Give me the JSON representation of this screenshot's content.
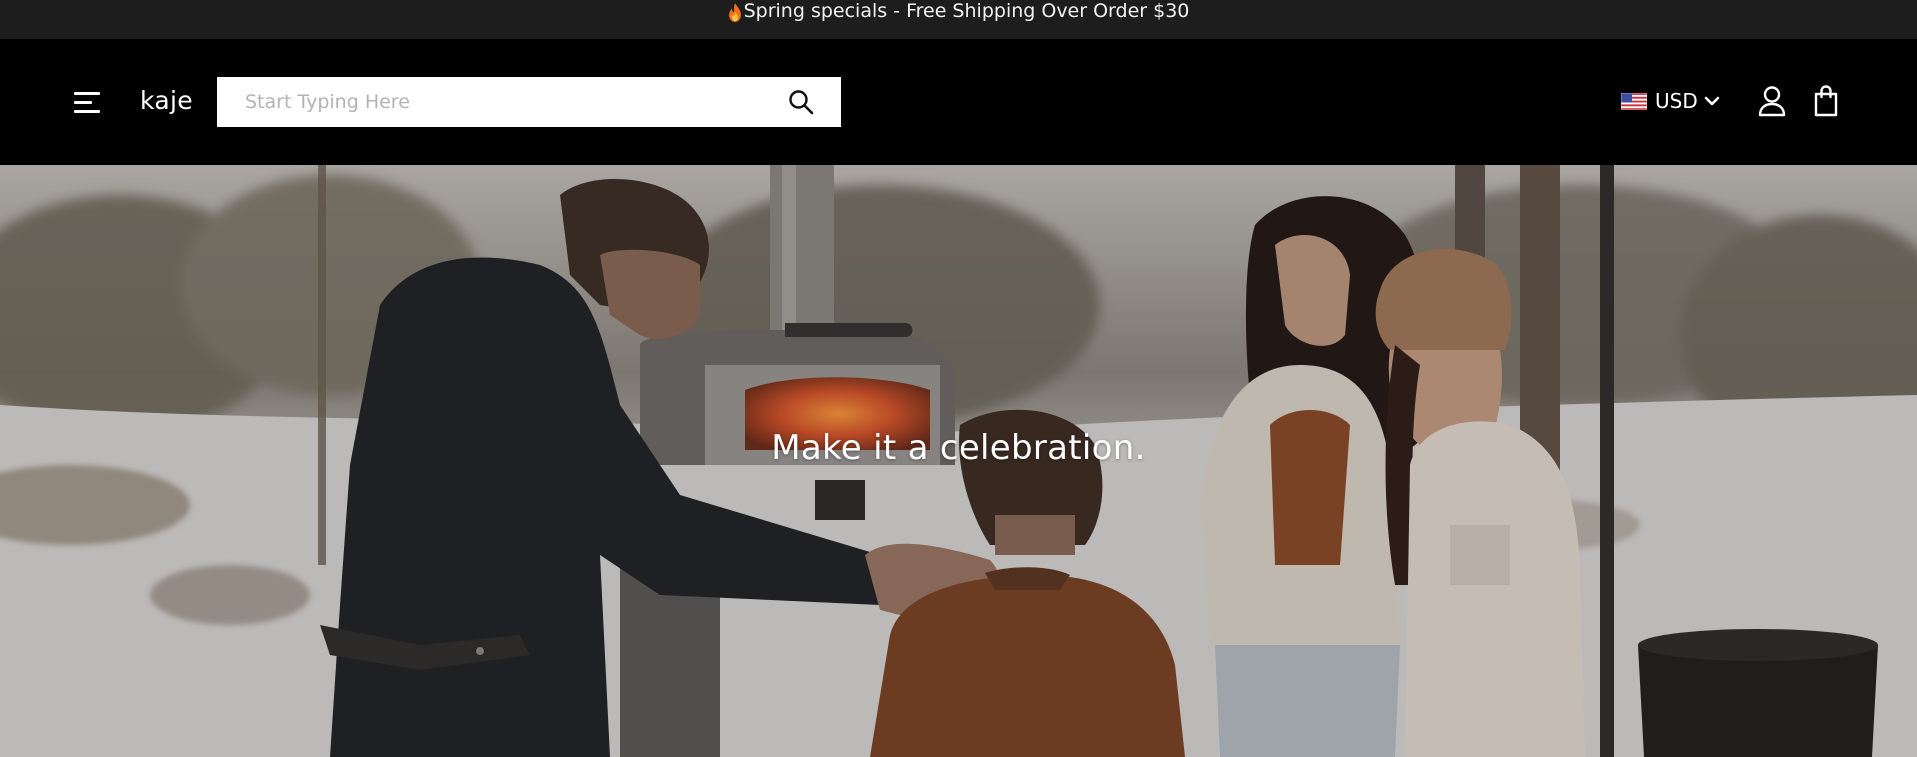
{
  "announcement": {
    "text": "Spring specials - Free Shipping Over Order $30",
    "icon": "flame-icon"
  },
  "header": {
    "menu_icon": "hamburger-menu-icon",
    "logo": "kaje",
    "search": {
      "placeholder": "Start Typing Here",
      "value": "",
      "icon": "search-icon"
    },
    "currency": {
      "flag": "us-flag-icon",
      "label": "USD",
      "icon": "chevron-down-icon"
    },
    "account_icon": "user-icon",
    "cart_icon": "shopping-bag-icon"
  },
  "hero": {
    "caption": "Make it a celebration.",
    "image": "family-around-outdoor-pizza-oven-in-snowy-forest"
  },
  "colors": {
    "announcement_bg": "#1d1d1d",
    "header_bg": "#000000",
    "search_bg": "#ffffff",
    "text": "#ffffff"
  }
}
